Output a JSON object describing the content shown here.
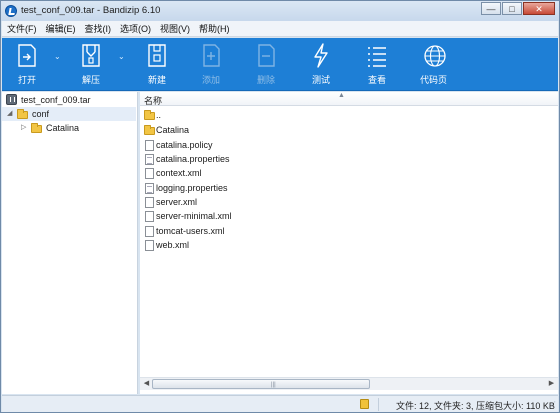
{
  "window": {
    "title": "test_conf_009.tar - Bandizip 6.10",
    "controls": {
      "minimize": "—",
      "maximize": "□",
      "close": "✕"
    }
  },
  "menu": [
    "文件(F)",
    "编辑(E)",
    "查找(I)",
    "选项(O)",
    "视图(V)",
    "帮助(H)"
  ],
  "toolbar": {
    "open": "打开",
    "extract": "解压",
    "new": "新建",
    "add": "添加",
    "delete": "删除",
    "test": "测试",
    "view": "查看",
    "codepage": "代码页"
  },
  "tree": {
    "archive": "test_conf_009.tar",
    "folder": "conf",
    "subfolder": "Catalina"
  },
  "list": {
    "column_name": "名称",
    "rows": [
      {
        "name": "..",
        "icon": "folder-icon"
      },
      {
        "name": "Catalina",
        "icon": "folder-icon"
      },
      {
        "name": "catalina.policy",
        "icon": "file-icon"
      },
      {
        "name": "catalina.properties",
        "icon": "text-file-icon"
      },
      {
        "name": "context.xml",
        "icon": "file-icon"
      },
      {
        "name": "logging.properties",
        "icon": "text-file-icon"
      },
      {
        "name": "server.xml",
        "icon": "file-icon"
      },
      {
        "name": "server-minimal.xml",
        "icon": "file-icon"
      },
      {
        "name": "tomcat-users.xml",
        "icon": "file-icon"
      },
      {
        "name": "web.xml",
        "icon": "file-icon"
      }
    ]
  },
  "status": {
    "summary": "文件: 12, 文件夹: 3, 压缩包大小: 110 KB"
  },
  "colors": {
    "toolbar_bg": "#1e7fd6",
    "selection_bg": "#e4edf8",
    "folder": "#f2c544"
  }
}
